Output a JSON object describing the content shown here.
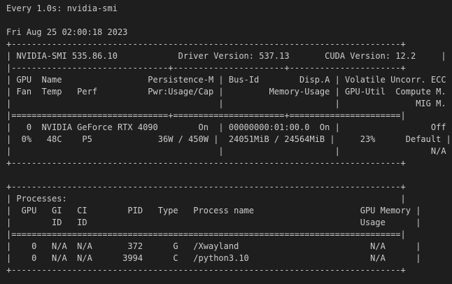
{
  "terminal": {
    "watch_header": "Every 1.0s: nvidia-smi",
    "timestamp": "Fri Aug 25 02:00:18 2023"
  },
  "smi": {
    "border_top": "+-----------------------------------------------------------------------------+",
    "version_line": "| NVIDIA-SMI 535.86.10            Driver Version: 537.13       CUDA Version: 12.2     |",
    "separator": "|-------------------------------+----------------------+----------------------+",
    "header_line_1": "| GPU  Name                 Persistence-M | Bus-Id        Disp.A | Volatile Uncorr. ECC |",
    "header_line_2": "| Fan  Temp   Perf          Pwr:Usage/Cap |         Memory-Usage | GPU-Util  Compute M. |",
    "header_line_3": "|                                         |                      |               MIG M. |",
    "double_separator": "|===============================+======================+======================|",
    "gpu_line_1": "|   0  NVIDIA GeForce RTX 4090        On  | 00000000:01:00.0  On |                  Off |",
    "gpu_line_2": "|  0%   48C    P5             36W / 450W |  24051MiB / 24564MiB |     23%      Default |",
    "gpu_line_3": "|                                         |                      |                  N/A |",
    "border_bottom": "+-----------------------------------------------------------------------------+"
  },
  "processes": {
    "border_top": "+-----------------------------------------------------------------------------+",
    "title_line": "| Processes:                                                                  |",
    "header_line_1": "|  GPU   GI   CI        PID   Type   Process name                     GPU Memory |",
    "header_line_2": "|        ID   ID                                                      Usage      |",
    "double_separator": "|=============================================================================|",
    "rows": [
      "|    0   N/A  N/A       372      G   /Xwayland                          N/A      |",
      "|    0   N/A  N/A      3994      C   /python3.10                        N/A      |"
    ],
    "border_bottom": "+-----------------------------------------------------------------------------+"
  }
}
